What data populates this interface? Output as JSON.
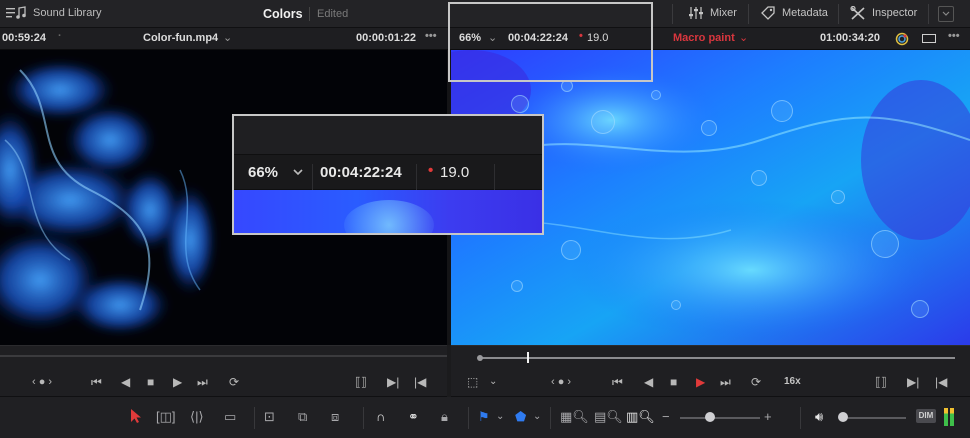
{
  "topbar": {
    "library_label": "Sound Library",
    "page_title": "Colors",
    "page_status": "Edited",
    "mixer_label": "Mixer",
    "metadata_label": "Metadata",
    "inspector_label": "Inspector"
  },
  "left_viewer": {
    "timecode_start": "00:59:24",
    "clip_name": "Color-fun.mp4",
    "clip_duration": "00:00:01:22"
  },
  "right_viewer": {
    "zoom": "66%",
    "timecode": "00:04:22:24",
    "fps": "19.0",
    "timeline_name": "Macro paint",
    "record_timecode": "01:00:34:20"
  },
  "zoom_callout": {
    "zoom": "66%",
    "timecode": "00:04:22:24",
    "fps": "19.0"
  },
  "transport": {
    "speed": "16x"
  },
  "toolbar": {
    "dim_label": "DIM"
  },
  "colors": {
    "accent_red": "#e03a3a",
    "flag_blue": "#2f7bf0",
    "panel": "#1f1f22"
  }
}
